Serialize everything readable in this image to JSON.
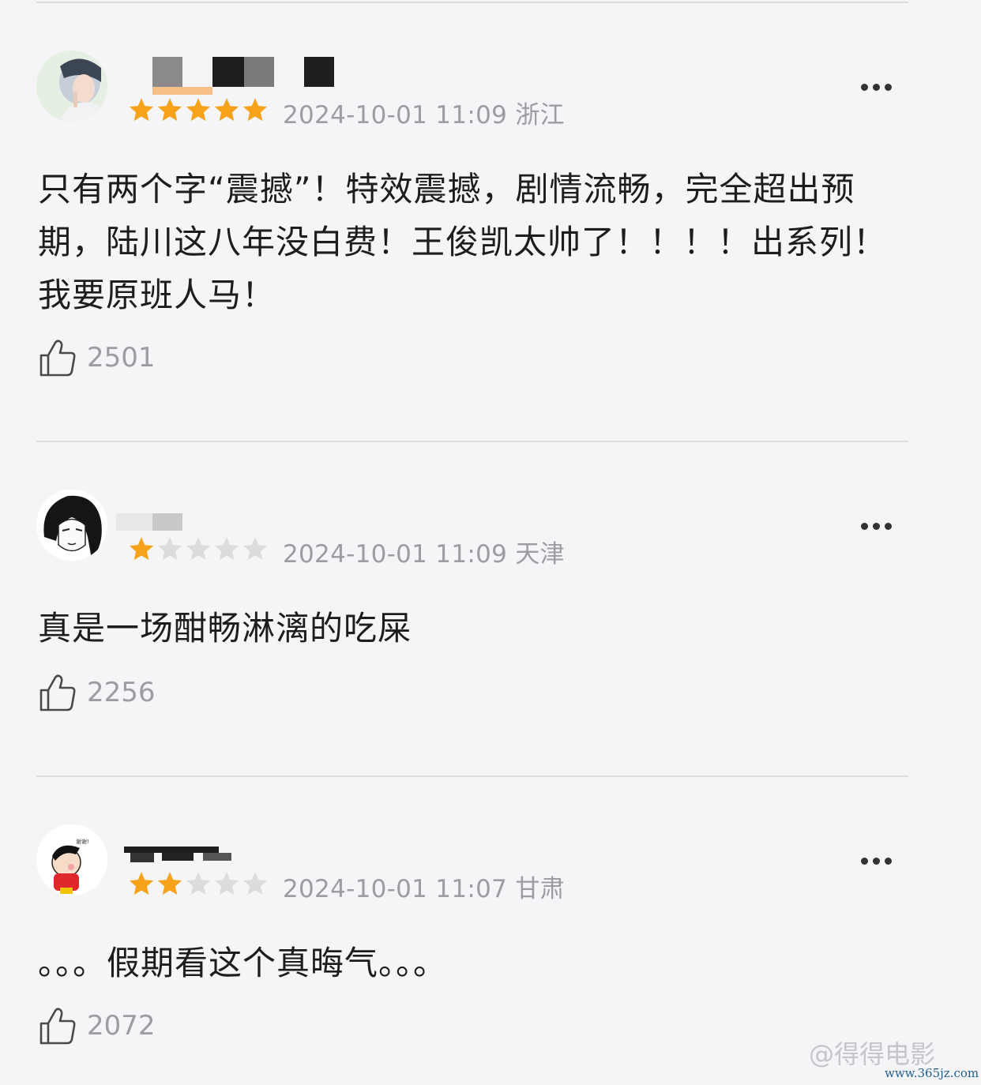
{
  "reviews": [
    {
      "rating": 5,
      "date": "2024-10-01 11:09",
      "location": "浙江",
      "content": "只有两个字“震撼”！特效震撼，剧情流畅，完全超出预期，陆川这八年没白费！王俊凯太帅了！！！！出系列！我要原班人马！",
      "likes": "2501"
    },
    {
      "rating": 1,
      "date": "2024-10-01 11:09",
      "location": "天津",
      "content": "真是一场酣畅淋漓的吃屎",
      "likes": "2256"
    },
    {
      "rating": 2,
      "date": "2024-10-01 11:07",
      "location": "甘肃",
      "content": "。。。假期看这个真晦气。。。",
      "likes": "2072"
    }
  ],
  "colors": {
    "star_filled": "#f7a21b",
    "star_empty": "#dcdcdf",
    "meta_text": "#9c9ca3",
    "background": "#f5f5f7"
  },
  "icons": [
    "thumbs-up-icon",
    "more-options-icon",
    "star-icon"
  ],
  "watermark": {
    "brand": "@得得电影",
    "site": "www.365jz.com"
  }
}
